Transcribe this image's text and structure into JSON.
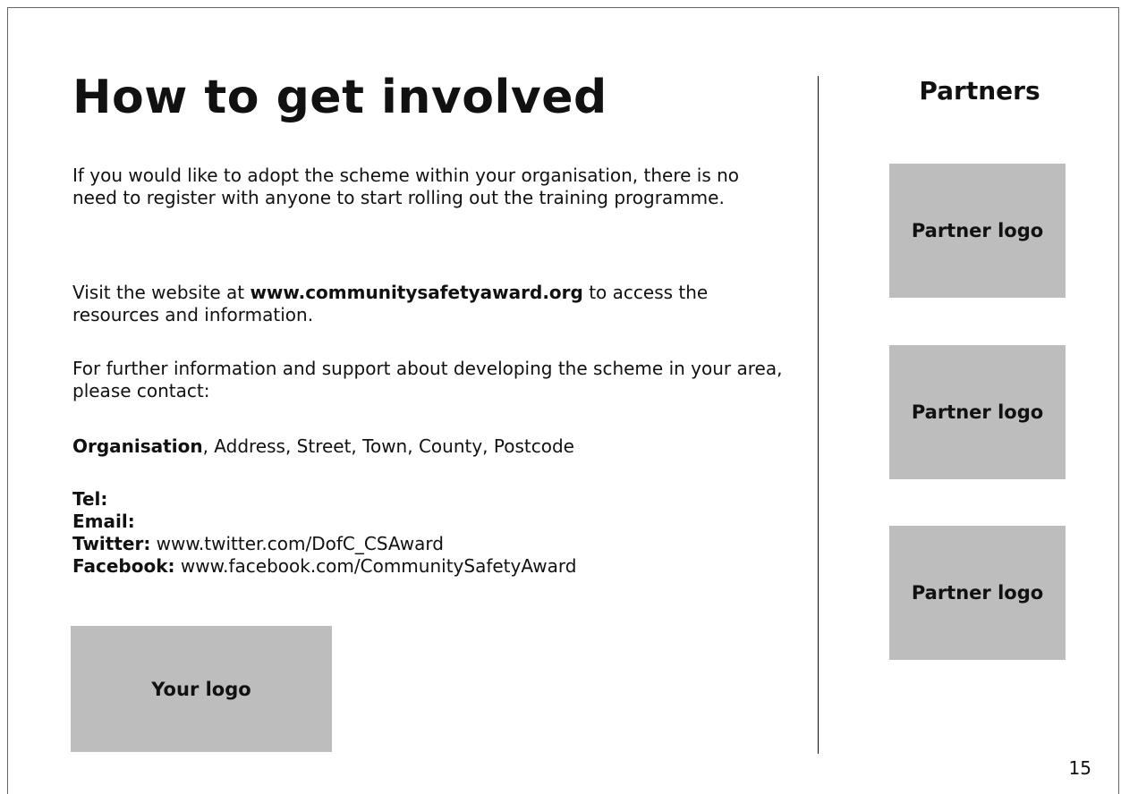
{
  "slide": {
    "title": "How to get involved",
    "paragraph1": "If you would like to adopt the scheme within your organisation, there is no need to register with anyone to start rolling out the training programme.",
    "paragraph2": {
      "prefix": "Visit the website at ",
      "website": "www.communitysafetyaward.org",
      "suffix": " to access the resources and information."
    },
    "paragraph3": "For further information and support about developing the scheme in your area, please contact:",
    "address": {
      "organisation": "Organisation",
      "rest": ", Address, Street, Town, County, Postcode"
    },
    "contacts": {
      "tel_label": "Tel:",
      "email_label": "Email:",
      "twitter_label": "Twitter:",
      "twitter_value": " www.twitter.com/DofC_CSAward",
      "facebook_label": "Facebook:",
      "facebook_value": " www.facebook.com/CommunitySafetyAward"
    },
    "your_logo": "Your logo",
    "partners": {
      "title": "Partners",
      "logos": [
        "Partner logo",
        "Partner logo",
        "Partner logo"
      ]
    },
    "page_number": "15"
  }
}
